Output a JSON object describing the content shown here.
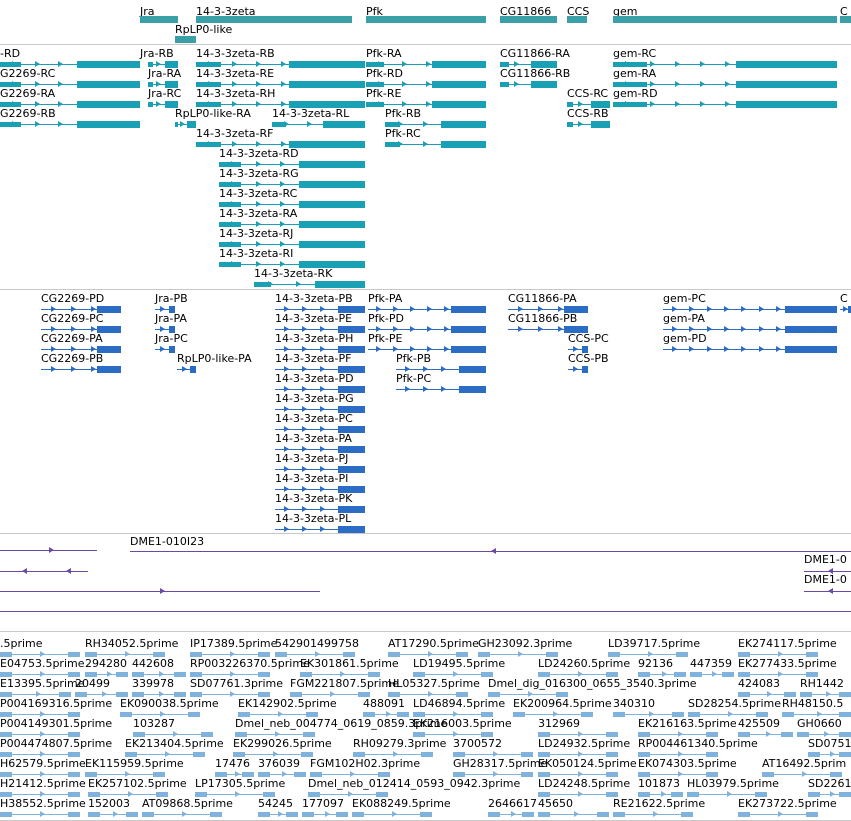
{
  "colors": {
    "gene": "#3a9fa6",
    "mrna_mod": "#1aa0b4",
    "mrna_other": "#2b6cc4",
    "region": "#6a4aa3",
    "est": "#7fb3dd",
    "divider": "#c8c8c8"
  },
  "gene_track": {
    "labels": [
      "Jra",
      "14-3-3zeta",
      "Pfk",
      "CG11866",
      "CCS",
      "gem",
      "C",
      "RpLP0-like"
    ]
  },
  "mrna_track": {
    "labels": [
      "-RD",
      "Jra-RB",
      "14-3-3zeta-RB",
      "Pfk-RA",
      "CG11866-RA",
      "gem-RC",
      "G2269-RC",
      "Jra-RA",
      "14-3-3zeta-RE",
      "Pfk-RD",
      "CG11866-RB",
      "gem-RA",
      "G2269-RA",
      "Jra-RC",
      "14-3-3zeta-RH",
      "Pfk-RE",
      "CCS-RC",
      "gem-RD",
      "G2269-RB",
      "RpLP0-like-RA",
      "14-3-3zeta-RL",
      "Pfk-RB",
      "CCS-RB",
      "14-3-3zeta-RF",
      "Pfk-RC",
      "14-3-3zeta-RD",
      "14-3-3zeta-RG",
      "14-3-3zeta-RC",
      "14-3-3zeta-RA",
      "14-3-3zeta-RJ",
      "14-3-3zeta-RI",
      "14-3-3zeta-RK"
    ]
  },
  "protein_track": {
    "labels": [
      "CG2269-PD",
      "Jra-PB",
      "14-3-3zeta-PB",
      "Pfk-PA",
      "CG11866-PA",
      "gem-PC",
      "C",
      "CG2269-PC",
      "Jra-PA",
      "14-3-3zeta-PE",
      "Pfk-PD",
      "CG11866-PB",
      "gem-PA",
      "CG2269-PA",
      "Jra-PC",
      "14-3-3zeta-PH",
      "Pfk-PE",
      "CCS-PC",
      "gem-PD",
      "CG2269-PB",
      "RpLP0-like-PA",
      "14-3-3zeta-PF",
      "Pfk-PB",
      "CCS-PB",
      "14-3-3zeta-PD",
      "Pfk-PC",
      "14-3-3zeta-PG",
      "14-3-3zeta-PC",
      "14-3-3zeta-PA",
      "14-3-3zeta-PJ",
      "14-3-3zeta-PI",
      "14-3-3zeta-PK",
      "14-3-3zeta-PL"
    ]
  },
  "region_track": {
    "labels": [
      "DME1-010I23",
      "DME1-0",
      "DME1-0"
    ]
  },
  "est_track": {
    "rows": [
      [
        ".5prime",
        "RH34052.5prime",
        "IP17389.5prime",
        "542901499758",
        "AT17290.5prime",
        "GH23092.3prime",
        "LD39717.5prime",
        "EK274117.5prime"
      ],
      [
        "E04753.5prime",
        "294280",
        "442608",
        "RP003226370.5prime",
        "EK301861.5prime",
        "LD19495.5prime",
        "LD24260.5prime",
        "92136",
        "447359",
        "EK277433.5prime"
      ],
      [
        "E13395.5prime",
        "20499",
        "339978",
        "SD07761.3prime",
        "FGM221807.5prime",
        "HL05327.5prime",
        "Dmel_dig_016300_0655_3540.3prime",
        "424083",
        "RH1442"
      ],
      [
        "P004169316.5prime",
        "EK090038.5prime",
        "EK142902.5prime",
        "488091",
        "LD46894.5prime",
        "EK200964.5prime",
        "340310",
        "SD28254.5prime",
        "RH48150.5"
      ],
      [
        "P004149301.5prime",
        "103287",
        "Dmel_neb_004774_0619_0859.3prime",
        "EK216003.5prime",
        "312969",
        "EK216163.5prime",
        "425509",
        "GH0660"
      ],
      [
        "P004474807.5prime",
        "EK213404.5prime",
        "EK299026.5prime",
        "RH09279.3prime",
        "3700572",
        "LD24932.5prime",
        "RP004461340.5prime",
        "SD0751"
      ],
      [
        "H62579.5prime",
        "EK115959.5prime",
        "17476",
        "376039",
        "FGM102H02.3prime",
        "GH28317.5prime",
        "EK050124.5prime",
        "EK074303.5prime",
        "AT16492.5prim"
      ],
      [
        "H21412.5prime",
        "EK257102.5prime",
        "LP17305.5prime",
        "Dmel_neb_012414_0593_0942.3prime",
        "LD24248.5prime",
        "101873",
        "HL03979.5prime",
        "SD2261"
      ],
      [
        "H38552.5prime",
        "152003",
        "AT09868.5prime",
        "54245",
        "177097",
        "EK088249.5prime",
        "2646617",
        "45650",
        "RE21622.5prime",
        "EK273722.5prime"
      ]
    ]
  }
}
